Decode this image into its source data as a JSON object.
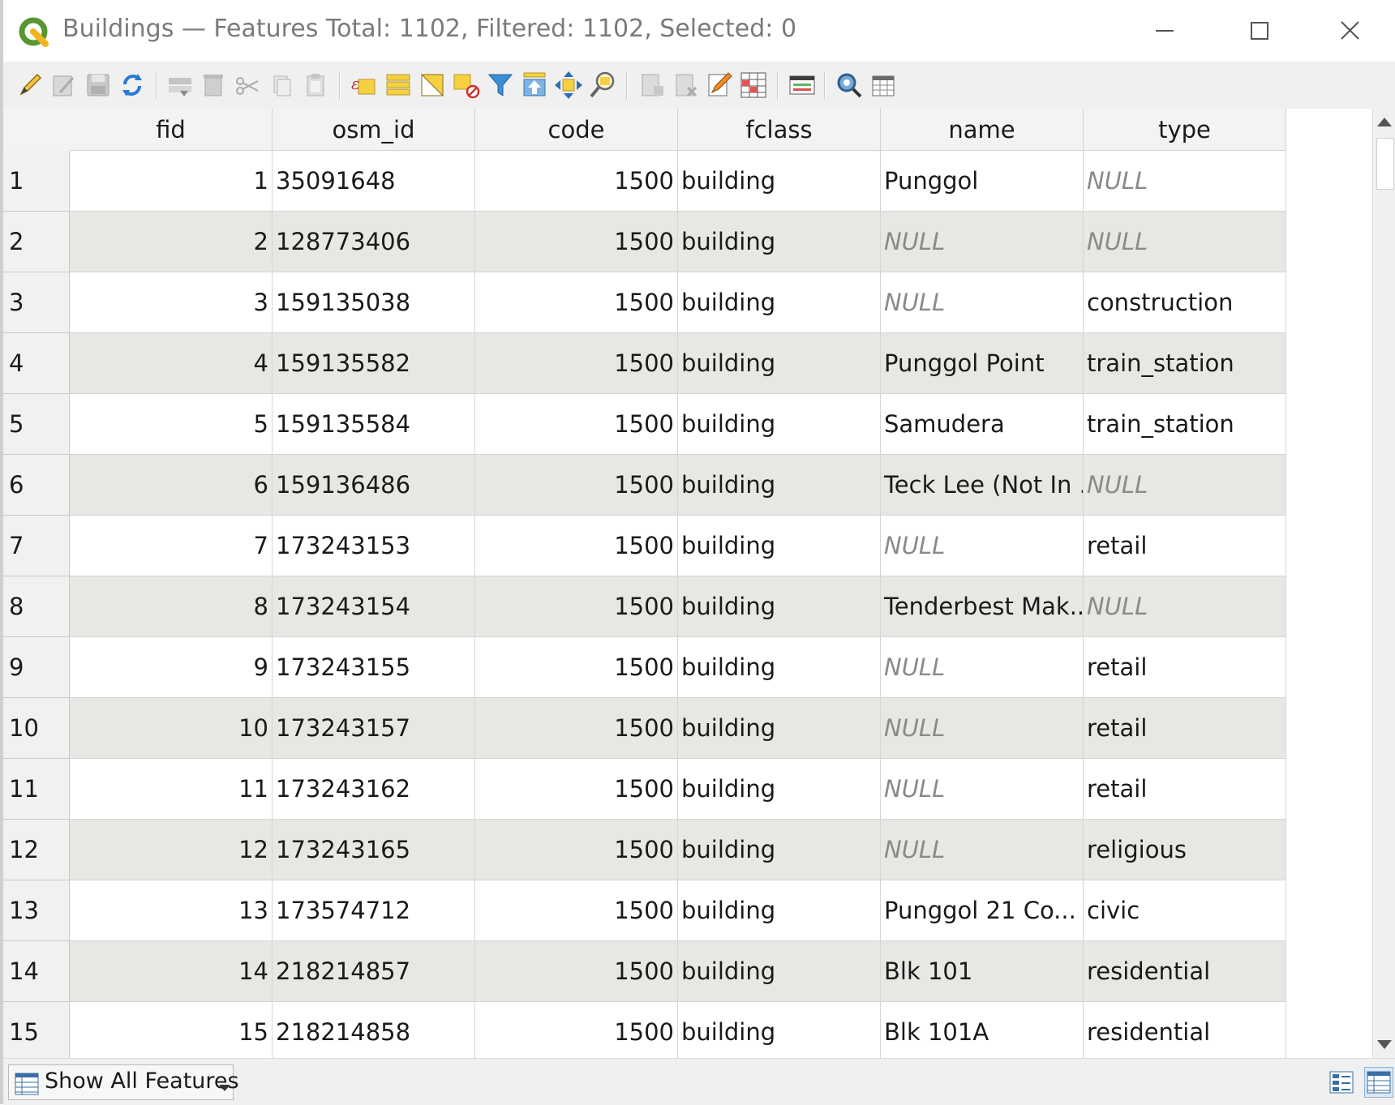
{
  "window": {
    "title": "Buildings — Features Total: 1102, Filtered: 1102, Selected: 0",
    "minimize_icon": "minimize-icon",
    "maximize_icon": "maximize-icon",
    "close_icon": "close-icon"
  },
  "toolbar": {
    "buttons": [
      "toggle-editing-icon",
      "toggle-multi-edit-icon",
      "save-edits-icon",
      "reload-table-icon",
      "add-feature-icon",
      "delete-selected-icon",
      "cut-icon",
      "copy-icon",
      "paste-icon",
      "select-by-expression-icon",
      "select-all-icon",
      "invert-selection-icon",
      "deselect-all-icon",
      "filter-select-icon",
      "move-selection-top-icon",
      "pan-to-selected-icon",
      "zoom-to-selected-icon",
      "new-field-icon",
      "delete-field-icon",
      "field-calculator-icon",
      "conditional-formatting-icon",
      "dock-table-icon",
      "actions-icon",
      "organize-columns-icon"
    ]
  },
  "table": {
    "columns": [
      "fid",
      "osm_id",
      "code",
      "fclass",
      "name",
      "type"
    ],
    "rows": [
      {
        "num": "1",
        "fid": "1",
        "osm_id": "35091648",
        "code": "1500",
        "fclass": "building",
        "name": "Punggol",
        "type": "NULL"
      },
      {
        "num": "2",
        "fid": "2",
        "osm_id": "128773406",
        "code": "1500",
        "fclass": "building",
        "name": "NULL",
        "type": "NULL"
      },
      {
        "num": "3",
        "fid": "3",
        "osm_id": "159135038",
        "code": "1500",
        "fclass": "building",
        "name": "NULL",
        "type": "construction"
      },
      {
        "num": "4",
        "fid": "4",
        "osm_id": "159135582",
        "code": "1500",
        "fclass": "building",
        "name": "Punggol Point",
        "type": "train_station"
      },
      {
        "num": "5",
        "fid": "5",
        "osm_id": "159135584",
        "code": "1500",
        "fclass": "building",
        "name": "Samudera",
        "type": "train_station"
      },
      {
        "num": "6",
        "fid": "6",
        "osm_id": "159136486",
        "code": "1500",
        "fclass": "building",
        "name": "Teck Lee (Not In ...",
        "type": "NULL"
      },
      {
        "num": "7",
        "fid": "7",
        "osm_id": "173243153",
        "code": "1500",
        "fclass": "building",
        "name": "NULL",
        "type": "retail"
      },
      {
        "num": "8",
        "fid": "8",
        "osm_id": "173243154",
        "code": "1500",
        "fclass": "building",
        "name": "Tenderbest Mak...",
        "type": "NULL"
      },
      {
        "num": "9",
        "fid": "9",
        "osm_id": "173243155",
        "code": "1500",
        "fclass": "building",
        "name": "NULL",
        "type": "retail"
      },
      {
        "num": "10",
        "fid": "10",
        "osm_id": "173243157",
        "code": "1500",
        "fclass": "building",
        "name": "NULL",
        "type": "retail"
      },
      {
        "num": "11",
        "fid": "11",
        "osm_id": "173243162",
        "code": "1500",
        "fclass": "building",
        "name": "NULL",
        "type": "retail"
      },
      {
        "num": "12",
        "fid": "12",
        "osm_id": "173243165",
        "code": "1500",
        "fclass": "building",
        "name": "NULL",
        "type": "religious"
      },
      {
        "num": "13",
        "fid": "13",
        "osm_id": "173574712",
        "code": "1500",
        "fclass": "building",
        "name": "Punggol 21 Co...",
        "type": "civic"
      },
      {
        "num": "14",
        "fid": "14",
        "osm_id": "218214857",
        "code": "1500",
        "fclass": "building",
        "name": "Blk 101",
        "type": "residential"
      },
      {
        "num": "15",
        "fid": "15",
        "osm_id": "218214858",
        "code": "1500",
        "fclass": "building",
        "name": "Blk 101A",
        "type": "residential"
      }
    ]
  },
  "footer": {
    "filter_button_label": "Show All Features",
    "form_view_icon": "form-view-icon",
    "table_view_icon": "table-view-icon"
  },
  "colors": {
    "null_text": "#8a8a8a",
    "alt_row": "#e8e7e4",
    "qgis_green": "#589632",
    "qgis_yellow": "#f0b41e"
  }
}
